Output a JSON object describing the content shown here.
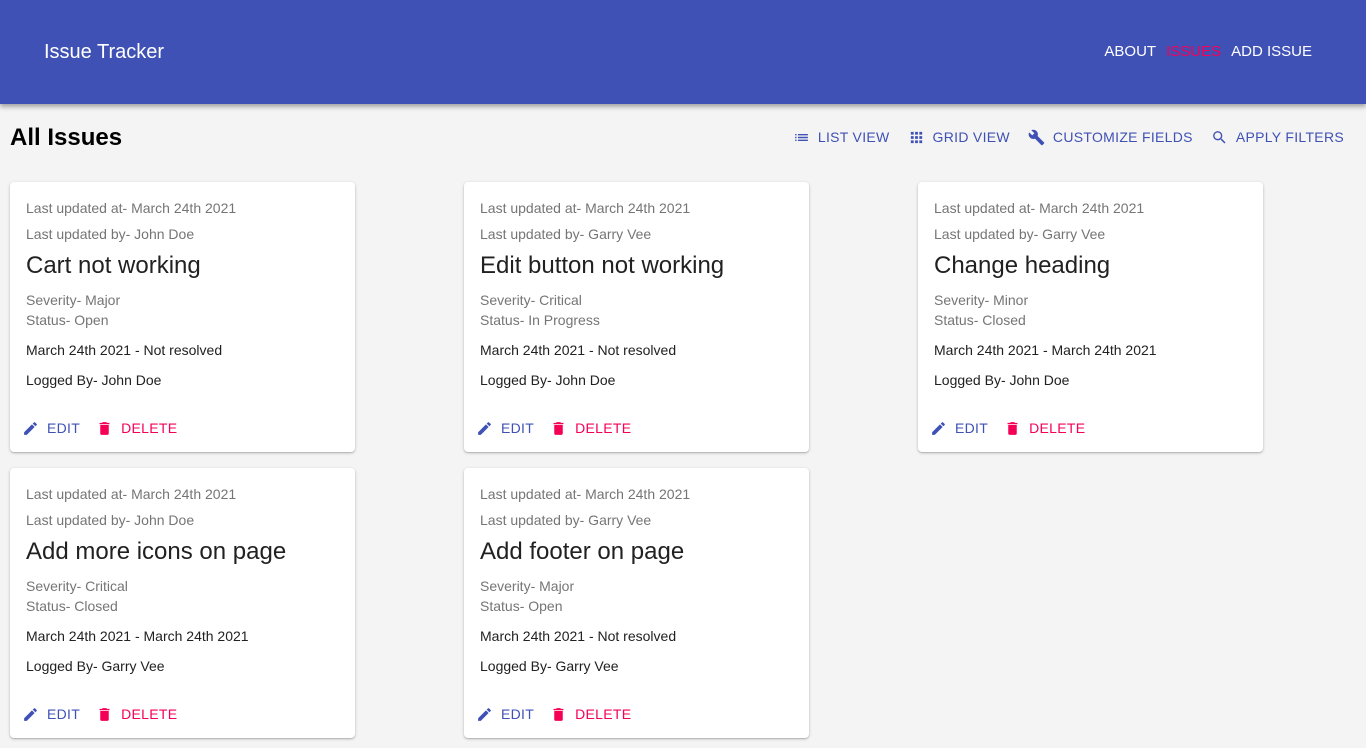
{
  "app": {
    "title": "Issue Tracker",
    "nav": [
      "ABOUT",
      "ISSUES",
      "ADD ISSUE"
    ],
    "active_nav": "ISSUES",
    "accent": "#3f51b5",
    "secondary": "#f50057"
  },
  "page": {
    "title": "All Issues",
    "toolbar": [
      {
        "label": "LIST VIEW",
        "icon": "list-icon"
      },
      {
        "label": "GRID VIEW",
        "icon": "grid-icon"
      },
      {
        "label": "CUSTOMIZE FIELDS",
        "icon": "wrench-icon"
      },
      {
        "label": "APPLY FILTERS",
        "icon": "search-icon"
      }
    ]
  },
  "issues": [
    {
      "updated_at": "Last updated at- March 24th 2021",
      "updated_by": "Last updated by- John Doe",
      "title": "Cart not working",
      "severity": "Severity- Major",
      "status": "Status- Open",
      "dates": "March 24th 2021 - Not resolved",
      "logged_by": "Logged By- John Doe",
      "edit_label": "EDIT",
      "delete_label": "DELETE"
    },
    {
      "updated_at": "Last updated at- March 24th 2021",
      "updated_by": "Last updated by- Garry Vee",
      "title": "Edit button not working",
      "severity": "Severity- Critical",
      "status": "Status- In Progress",
      "dates": "March 24th 2021 - Not resolved",
      "logged_by": "Logged By- John Doe",
      "edit_label": "EDIT",
      "delete_label": "DELETE"
    },
    {
      "updated_at": "Last updated at- March 24th 2021",
      "updated_by": "Last updated by- Garry Vee",
      "title": "Change heading",
      "severity": "Severity- Minor",
      "status": "Status- Closed",
      "dates": "March 24th 2021 - March 24th 2021",
      "logged_by": "Logged By- John Doe",
      "edit_label": "EDIT",
      "delete_label": "DELETE"
    },
    {
      "updated_at": "Last updated at- March 24th 2021",
      "updated_by": "Last updated by- John Doe",
      "title": "Add more icons on page",
      "severity": "Severity- Critical",
      "status": "Status- Closed",
      "dates": "March 24th 2021 - March 24th 2021",
      "logged_by": "Logged By- Garry Vee",
      "edit_label": "EDIT",
      "delete_label": "DELETE"
    },
    {
      "updated_at": "Last updated at- March 24th 2021",
      "updated_by": "Last updated by- Garry Vee",
      "title": "Add footer on page",
      "severity": "Severity- Major",
      "status": "Status- Open",
      "dates": "March 24th 2021 - Not resolved",
      "logged_by": "Logged By- Garry Vee",
      "edit_label": "EDIT",
      "delete_label": "DELETE"
    }
  ]
}
